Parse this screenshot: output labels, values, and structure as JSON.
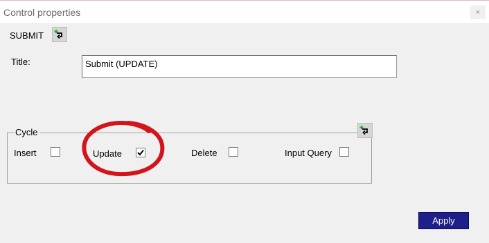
{
  "window": {
    "title": "Control properties",
    "close_glyph": "×"
  },
  "control": {
    "name": "SUBMIT",
    "link_icon": "link-add-icon"
  },
  "form": {
    "title_label": "Title:",
    "title_value": "Submit (UPDATE)"
  },
  "cycle": {
    "legend": "Cycle",
    "link_icon": "link-add-icon",
    "options": [
      {
        "label": "Insert",
        "checked": false
      },
      {
        "label": "Update",
        "checked": true
      },
      {
        "label": "Delete",
        "checked": false
      },
      {
        "label": "Input Query",
        "checked": false
      }
    ]
  },
  "actions": {
    "apply_label": "Apply"
  },
  "colors": {
    "background": "#f0f0f0",
    "apply_button": "#1f1f8c",
    "annotation_circle": "#d4141b",
    "icon_green": "#1db31d"
  }
}
